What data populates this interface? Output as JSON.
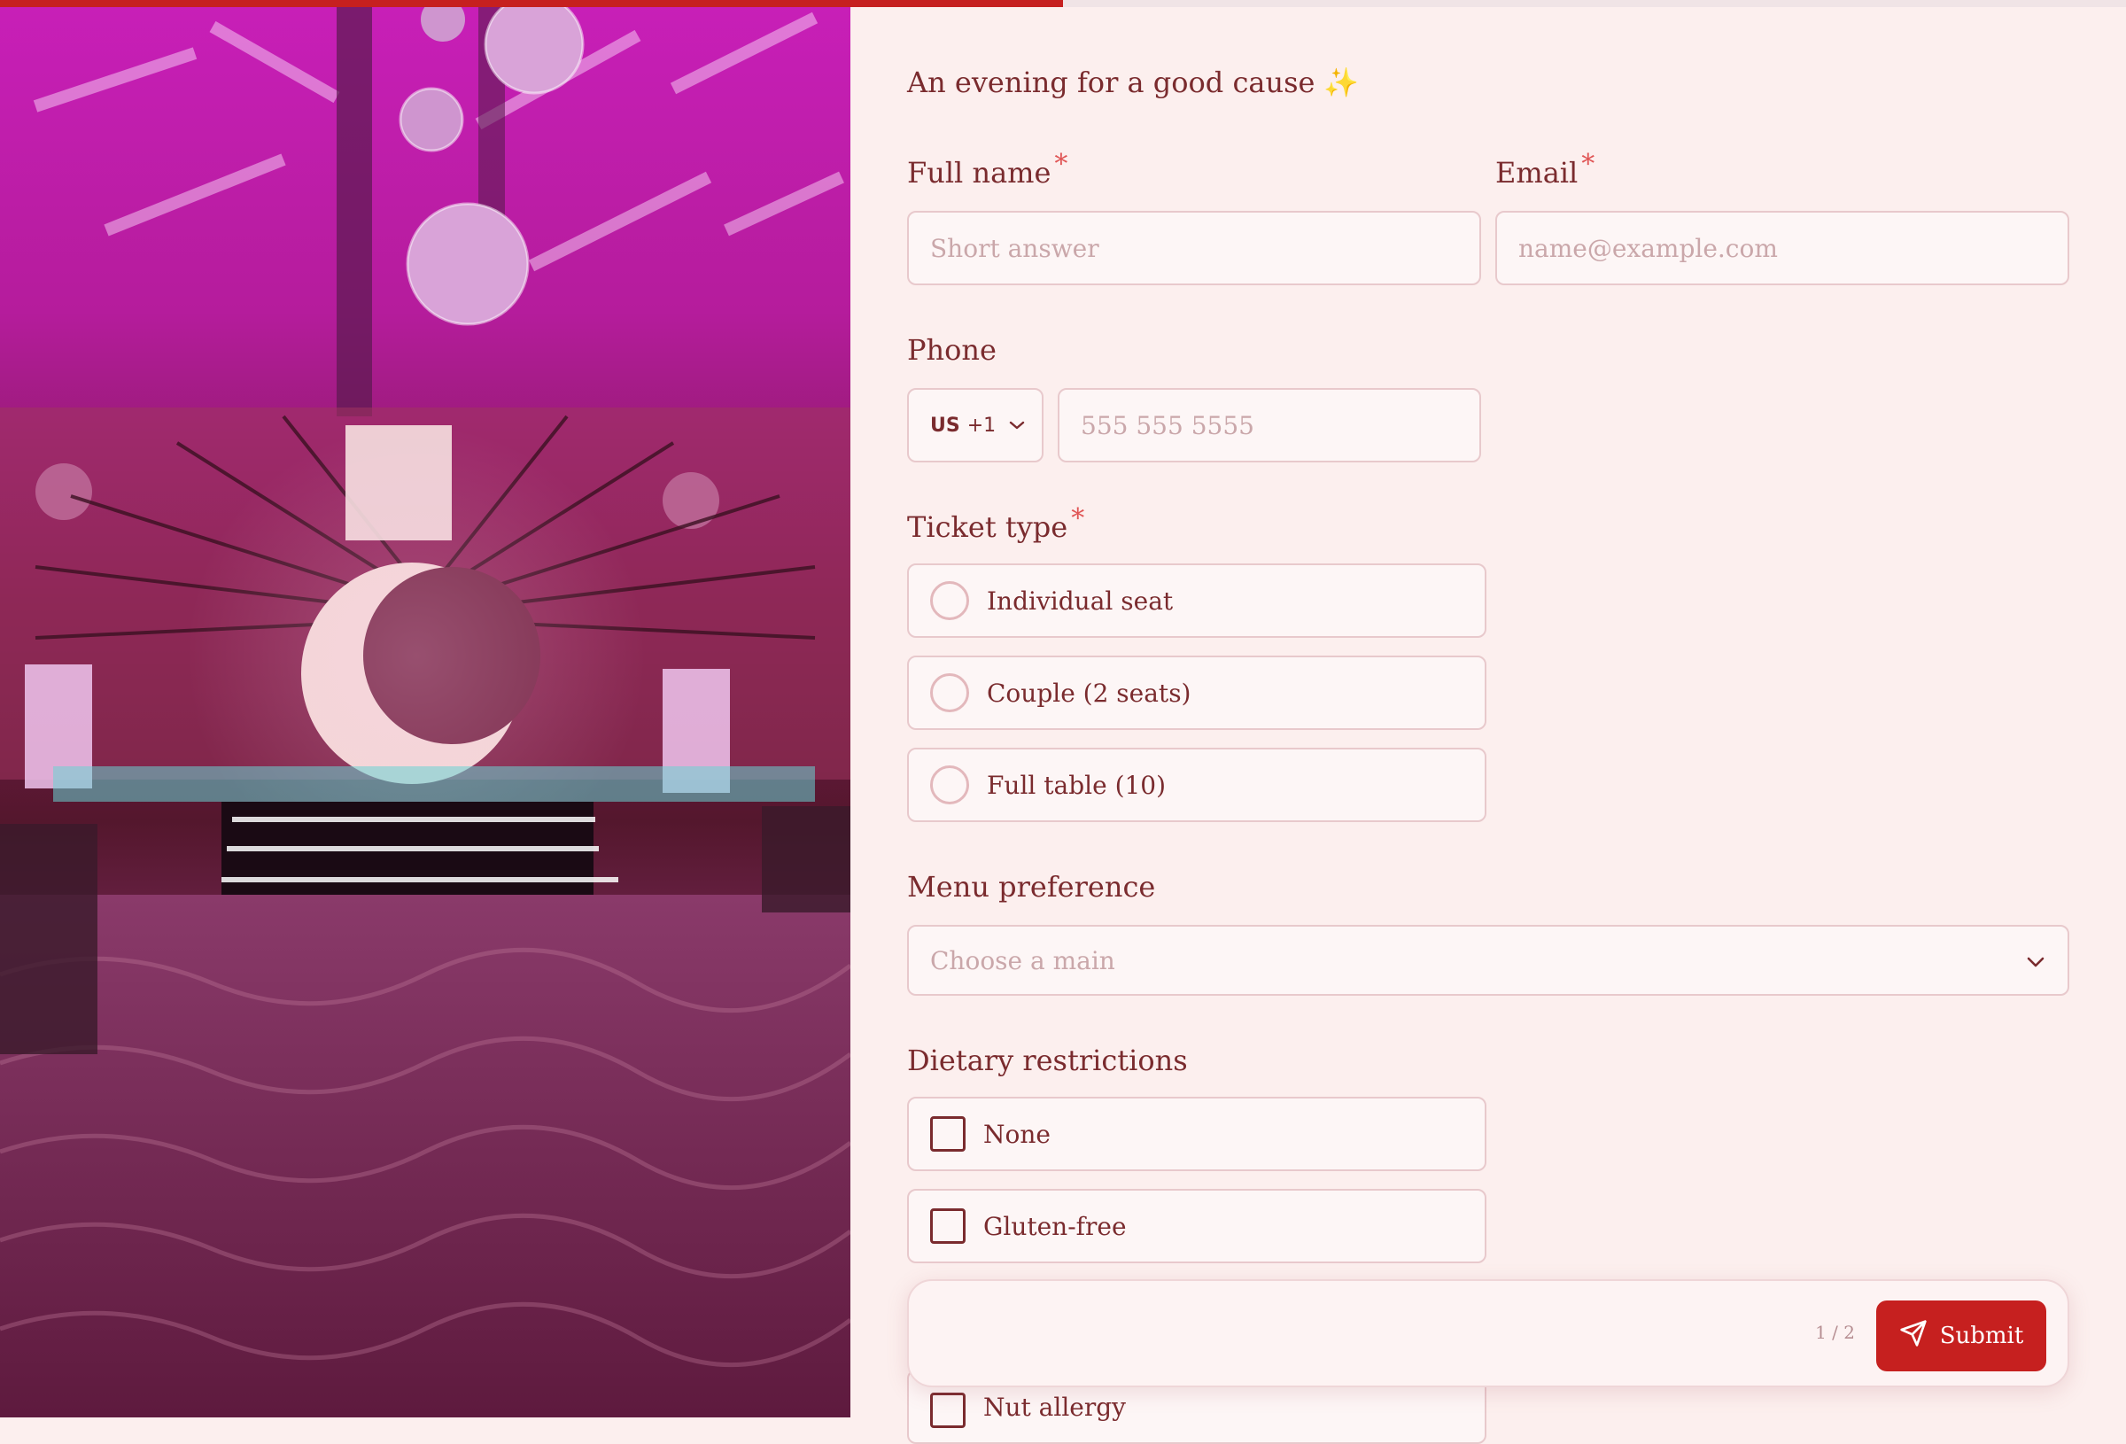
{
  "progress": {
    "fraction": 0.5
  },
  "form": {
    "heading": "An evening for a good cause",
    "heading_emoji": "✨",
    "full_name": {
      "label": "Full name",
      "required_mark": "*",
      "placeholder": "Short answer"
    },
    "email": {
      "label": "Email",
      "required_mark": "*",
      "placeholder": "name@example.com"
    },
    "phone": {
      "label": "Phone",
      "country_code": "US",
      "dial_code": "+1",
      "placeholder": "555 555 5555"
    },
    "ticket_type": {
      "label": "Ticket type",
      "required_mark": "*",
      "options": [
        "Individual seat",
        "Couple (2 seats)",
        "Full table (10)"
      ]
    },
    "menu": {
      "label": "Menu preference",
      "placeholder": "Choose a main"
    },
    "dietary": {
      "label": "Dietary restrictions",
      "options": [
        "None",
        "Gluten-free",
        "Nut allergy"
      ]
    },
    "footer": {
      "page_count": "1 / 2",
      "submit_label": "Submit"
    }
  },
  "colors": {
    "accent": "#c6201f",
    "text": "#7a2b2e",
    "border": "#e8c9cc",
    "background": "#fcefee"
  },
  "icons": [
    "sparkle-icon",
    "chevron-down-icon",
    "send-icon"
  ]
}
